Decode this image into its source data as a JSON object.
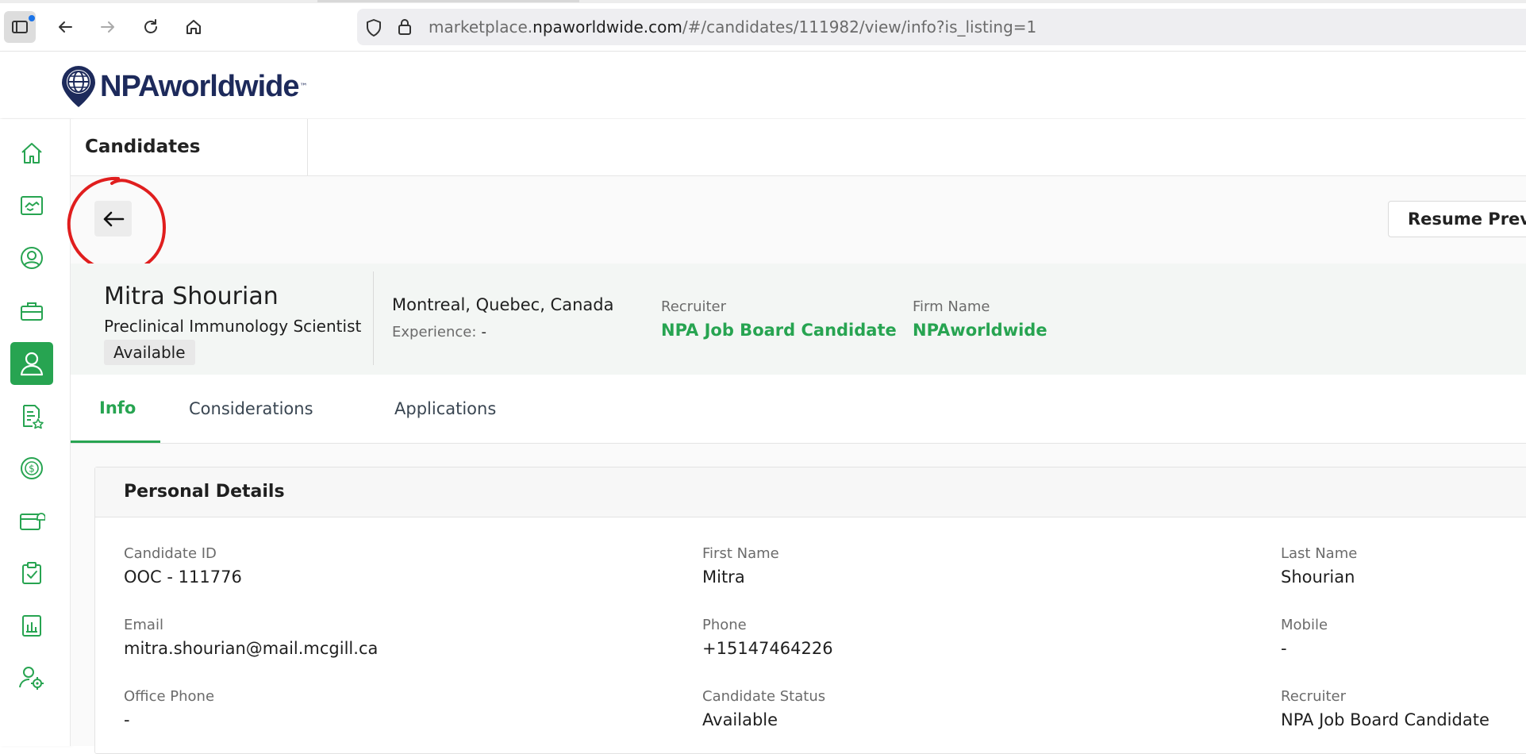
{
  "browser": {
    "url_prefix": "marketplace.",
    "url_domain": "npaworldwide.com",
    "url_path": "/#/candidates/111982/view/info?is_listing=1"
  },
  "brand": {
    "logo_text": "NPAworldwide",
    "logo_tm": "™"
  },
  "sidebar": {
    "items": [
      {
        "icon": "home-icon"
      },
      {
        "icon": "handshake-icon"
      },
      {
        "icon": "user-circle-icon"
      },
      {
        "icon": "briefcase-icon"
      },
      {
        "icon": "candidate-icon",
        "active": true
      },
      {
        "icon": "document-star-icon"
      },
      {
        "icon": "dollar-icon"
      },
      {
        "icon": "wallet-icon"
      },
      {
        "icon": "clipboard-check-icon"
      },
      {
        "icon": "report-icon"
      },
      {
        "icon": "user-settings-icon"
      }
    ],
    "accent": "#27a451"
  },
  "page": {
    "title": "Candidates",
    "back_icon": "arrow-left-icon",
    "resume_button": "Resume Previe"
  },
  "candidate": {
    "name": "Mitra Shourian",
    "title": "Preclinical Immunology Scientist",
    "status": "Available",
    "location": "Montreal, Quebec, Canada",
    "experience_label": "Experience:",
    "experience_value": "-",
    "recruiter_label": "Recruiter",
    "recruiter_value": "NPA Job Board Candidate",
    "firm_label": "Firm Name",
    "firm_value": "NPAworldwide"
  },
  "tabs": [
    {
      "label": "Info",
      "active": true
    },
    {
      "label": "Considerations"
    },
    {
      "label": "Applications"
    }
  ],
  "details": {
    "title": "Personal Details",
    "fields": [
      {
        "label": "Candidate ID",
        "value": "OOC - 111776"
      },
      {
        "label": "First Name",
        "value": "Mitra"
      },
      {
        "label": "Last Name",
        "value": "Shourian"
      },
      {
        "label": "Email",
        "value": "mitra.shourian@mail.mcgill.ca"
      },
      {
        "label": "Phone",
        "value": "+15147464226"
      },
      {
        "label": "Mobile",
        "value": "-"
      },
      {
        "label": "Office Phone",
        "value": "-"
      },
      {
        "label": "Candidate Status",
        "value": "Available"
      },
      {
        "label": "Recruiter",
        "value": "NPA Job Board Candidate"
      }
    ]
  }
}
